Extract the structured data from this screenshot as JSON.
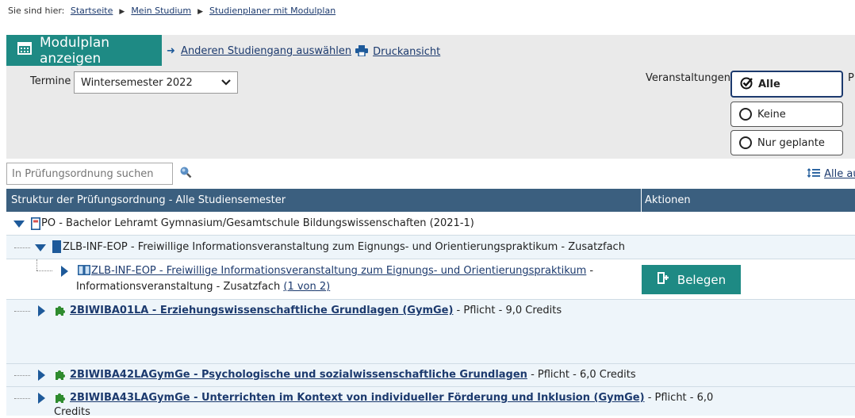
{
  "breadcrumb": {
    "prefix": "Sie sind hier:",
    "items": [
      "Startseite",
      "Mein Studium",
      "Studienplaner mit Modulplan"
    ]
  },
  "toolbar": {
    "modulplan_label": "Modulplan anzeigen",
    "studiengang_label": "Anderen Studiengang auswählen",
    "druck_label": "Druckansicht"
  },
  "filters": {
    "termine_label": "Termine",
    "termine_value": "Wintersemester 2022",
    "veranstaltungen_label": "Veranstaltungen:",
    "options": [
      "Alle",
      "Keine",
      "Nur geplante"
    ],
    "cut_label": "P"
  },
  "search": {
    "placeholder": "In Prüfungsordnung suchen",
    "expand_all_label": "Alle au"
  },
  "table": {
    "header_structure": "Struktur der Prüfungsordnung - Alle Studiensemester",
    "header_actions": "Aktionen",
    "po_row": "PO - Bachelor Lehramt Gymnasium/Gesamtschule Bildungswissenschaften (2021-1)",
    "zlb_row": "ZLB-INF-EOP - Freiwillige Informationsveranstaltung zum Eignungs- und Orientierungspraktikum - Zusatzfach",
    "event_link": "ZLB-INF-EOP - Freiwillige Informationsveranstaltung zum Eignungs- und Orientierungspraktikum",
    "event_suffix": " -",
    "event_line2": "Informationsveranstaltung - Zusatzfach ",
    "event_count": "(1 von 2)",
    "belegen_label": "Belegen",
    "modules": [
      {
        "link": "2BIWIBA01LA - Erziehungswissenschaftliche Grundlagen (GymGe)",
        "info": " - Pflicht - 9,0 Credits"
      },
      {
        "link": "2BIWIBA42LAGymGe - Psychologische und sozialwissenschaftliche Grundlagen",
        "info": " - Pflicht - 6,0 Credits"
      },
      {
        "link": "2BIWIBA43LAGymGe - Unterrichten im Kontext von individueller Förderung und Inklusion (GymGe)",
        "info": " - Pflicht - 6,0",
        "info2": "Credits"
      }
    ]
  },
  "colors": {
    "teal": "#1e8a84",
    "header": "#3b5f7f",
    "row_bg": "#eef5fa",
    "link": "#1c3a6e"
  }
}
